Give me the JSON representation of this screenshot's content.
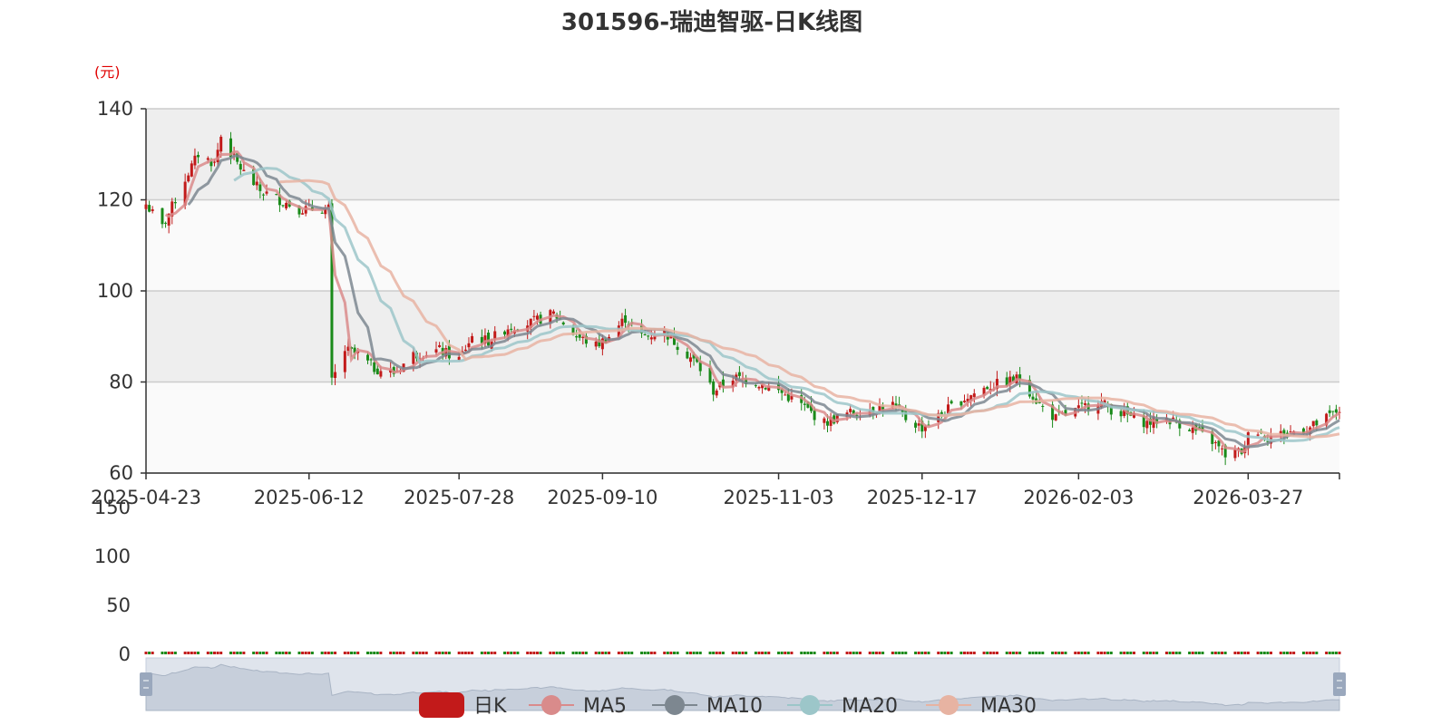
{
  "chart_data": {
    "type": "candlestick",
    "title": "301596-瑞迪智驱-日K线图",
    "y_unit": "(元)",
    "ylim": [
      60,
      140
    ],
    "yticks": [
      "60",
      "80",
      "100",
      "120",
      "140"
    ],
    "volume_ylim": [
      0,
      150
    ],
    "volume_yticks": [
      "0",
      "50",
      "100",
      "150"
    ],
    "x_start": "2025-04-23",
    "x_end": "2026-04-24",
    "x_ticks": [
      "2025-04-23",
      "2025-06-12",
      "2025-07-28",
      "2025-09-10",
      "2025-11-03",
      "2025-12-17",
      "2026-02-03",
      "2026-03-27"
    ],
    "grid": true,
    "legend_position": "bottom-center",
    "colors": {
      "up": "#c21a1a",
      "down": "#1a8a1a",
      "ma5": "#d98b8b",
      "ma10": "#7d8790",
      "ma20": "#9cc6c9",
      "ma30": "#e7b3a2",
      "band_dark": "#eeeeee",
      "band_light": "#fafafa",
      "slider_fill": "#dfe4ec",
      "slider_handle": "#9aa8bd"
    },
    "legend": [
      {
        "name": "日K",
        "key": "up"
      },
      {
        "name": "MA5",
        "key": "ma5"
      },
      {
        "name": "MA10",
        "key": "ma10"
      },
      {
        "name": "MA20",
        "key": "ma20"
      },
      {
        "name": "MA30",
        "key": "ma30"
      }
    ],
    "close_anchors": [
      [
        "2025-04-23",
        119
      ],
      [
        "2025-04-28",
        114
      ],
      [
        "2025-05-06",
        126
      ],
      [
        "2025-05-09",
        130
      ],
      [
        "2025-05-14",
        128
      ],
      [
        "2025-05-16",
        134
      ],
      [
        "2025-05-20",
        129
      ],
      [
        "2025-05-23",
        126
      ],
      [
        "2025-05-28",
        122
      ],
      [
        "2025-06-03",
        120
      ],
      [
        "2025-06-09",
        118
      ],
      [
        "2025-06-13",
        118
      ],
      [
        "2025-06-18",
        118
      ],
      [
        "2025-06-19",
        80
      ],
      [
        "2025-06-23",
        87
      ],
      [
        "2025-06-27",
        86
      ],
      [
        "2025-07-02",
        83
      ],
      [
        "2025-07-08",
        82
      ],
      [
        "2025-07-14",
        86
      ],
      [
        "2025-07-22",
        87
      ],
      [
        "2025-07-28",
        85
      ],
      [
        "2025-08-01",
        90
      ],
      [
        "2025-08-06",
        89
      ],
      [
        "2025-08-12",
        92
      ],
      [
        "2025-08-19",
        93
      ],
      [
        "2025-08-26",
        95
      ],
      [
        "2025-08-29",
        93
      ],
      [
        "2025-09-02",
        90
      ],
      [
        "2025-09-08",
        88
      ],
      [
        "2025-09-12",
        90
      ],
      [
        "2025-09-17",
        94
      ],
      [
        "2025-09-22",
        90
      ],
      [
        "2025-09-29",
        91
      ],
      [
        "2025-10-09",
        84
      ],
      [
        "2025-10-14",
        78
      ],
      [
        "2025-10-20",
        81
      ],
      [
        "2025-10-27",
        80
      ],
      [
        "2025-11-03",
        78
      ],
      [
        "2025-11-10",
        75
      ],
      [
        "2025-11-17",
        71
      ],
      [
        "2025-11-24",
        73
      ],
      [
        "2025-12-01",
        74
      ],
      [
        "2025-12-08",
        75
      ],
      [
        "2025-12-12",
        72
      ],
      [
        "2025-12-17",
        70
      ],
      [
        "2025-12-23",
        73
      ],
      [
        "2025-12-29",
        76
      ],
      [
        "2026-01-06",
        79
      ],
      [
        "2026-01-12",
        80
      ],
      [
        "2026-01-16",
        81
      ],
      [
        "2026-01-22",
        75
      ],
      [
        "2026-01-27",
        72
      ],
      [
        "2026-02-03",
        74
      ],
      [
        "2026-02-09",
        76
      ],
      [
        "2026-02-13",
        74
      ],
      [
        "2026-02-24",
        71
      ],
      [
        "2026-03-02",
        72
      ],
      [
        "2026-03-09",
        70
      ],
      [
        "2026-03-16",
        67
      ],
      [
        "2026-03-20",
        64
      ],
      [
        "2026-03-26",
        65
      ],
      [
        "2026-03-27",
        70
      ],
      [
        "2026-04-02",
        68
      ],
      [
        "2026-04-09",
        69
      ],
      [
        "2026-04-15",
        70
      ],
      [
        "2026-04-20",
        72
      ],
      [
        "2026-04-24",
        74
      ]
    ]
  }
}
